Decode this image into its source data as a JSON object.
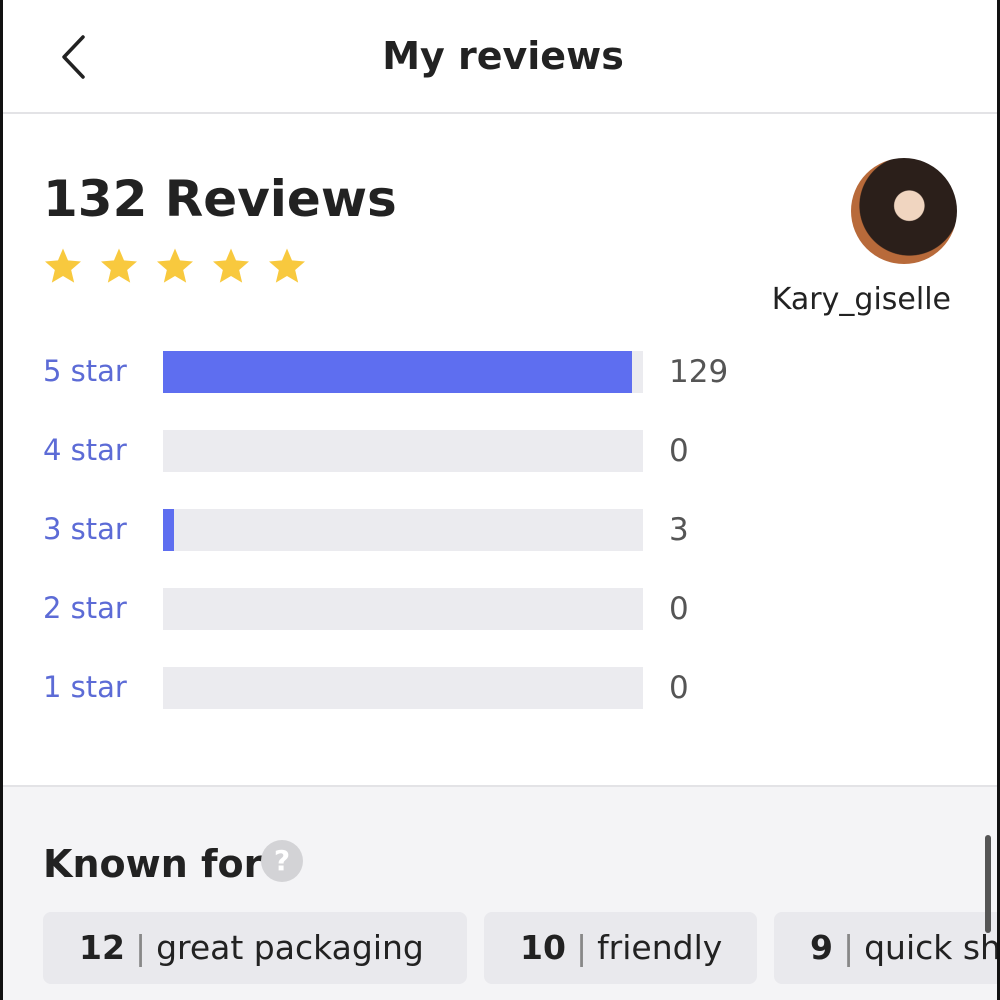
{
  "header": {
    "title": "My reviews",
    "back_icon": "chevron-left-icon"
  },
  "summary": {
    "heading": "132 Reviews",
    "stars": 5,
    "star_color": "#f8c93e",
    "username": "Kary_giselle"
  },
  "distribution": [
    {
      "label": "5 star",
      "count": "129",
      "fraction": 0.977
    },
    {
      "label": "4 star",
      "count": "0",
      "fraction": 0
    },
    {
      "label": "3 star",
      "count": "3",
      "fraction": 0.023
    },
    {
      "label": "2 star",
      "count": "0",
      "fraction": 0
    },
    {
      "label": "1 star",
      "count": "0",
      "fraction": 0
    }
  ],
  "colors": {
    "accent": "#5e6ef0",
    "label": "#5c6bd6",
    "track": "#ebebef"
  },
  "known_for": {
    "title": "Known for",
    "help_icon": "question-icon",
    "help_glyph": "?",
    "chips": [
      {
        "count": "12",
        "label": "great packaging"
      },
      {
        "count": "10",
        "label": "friendly"
      },
      {
        "count": "9",
        "label": "quick sh"
      }
    ]
  }
}
